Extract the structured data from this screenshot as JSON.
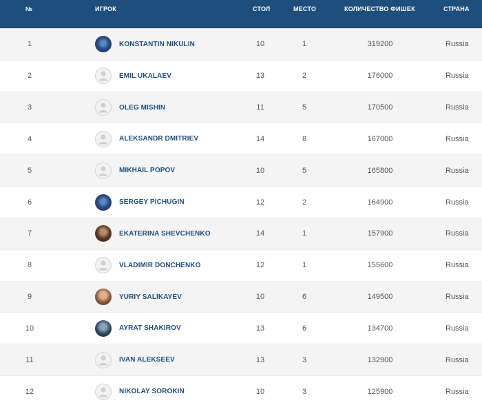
{
  "header": {
    "num": "№",
    "player": "ИГРОК",
    "table": "СТОЛ",
    "seat": "МЕСТО",
    "chips": "КОЛИЧЕСТВО ФИШЕК",
    "country": "СТРАНА"
  },
  "colors": {
    "header_bg": "#1e4e7c",
    "player_name": "#1e4e7c",
    "row_odd": "#f4f4f4",
    "row_even": "#ffffff",
    "cell_text": "#555555"
  },
  "rows": [
    {
      "num": "1",
      "avatar": "photo-blue",
      "name": "KONSTANTIN NIKULIN",
      "table": "10",
      "seat": "1",
      "chips": "319200",
      "country": "Russia"
    },
    {
      "num": "2",
      "avatar": "placeholder",
      "name": "EMIL UKALAEV",
      "table": "13",
      "seat": "2",
      "chips": "176000",
      "country": "Russia"
    },
    {
      "num": "3",
      "avatar": "placeholder",
      "name": "OLEG MISHIN",
      "table": "11",
      "seat": "5",
      "chips": "170500",
      "country": "Russia"
    },
    {
      "num": "4",
      "avatar": "placeholder",
      "name": "ALEKSANDR DMITRIEV",
      "table": "14",
      "seat": "8",
      "chips": "167000",
      "country": "Russia"
    },
    {
      "num": "5",
      "avatar": "placeholder",
      "name": "MIKHAIL POPOV",
      "table": "10",
      "seat": "5",
      "chips": "165800",
      "country": "Russia"
    },
    {
      "num": "6",
      "avatar": "photo-blue",
      "name": "SERGEY PICHUGIN",
      "table": "12",
      "seat": "2",
      "chips": "164900",
      "country": "Russia"
    },
    {
      "num": "7",
      "avatar": "photo-dark",
      "name": "EKATERINA SHEVCHENKO",
      "table": "14",
      "seat": "1",
      "chips": "157900",
      "country": "Russia"
    },
    {
      "num": "8",
      "avatar": "placeholder",
      "name": "VLADIMIR DONCHENKO",
      "table": "12",
      "seat": "1",
      "chips": "155600",
      "country": "Russia"
    },
    {
      "num": "9",
      "avatar": "photo-warm",
      "name": "YURIY SALIKAYEV",
      "table": "10",
      "seat": "6",
      "chips": "149500",
      "country": "Russia"
    },
    {
      "num": "10",
      "avatar": "photo-teal",
      "name": "AYRAT SHAKIROV",
      "table": "13",
      "seat": "6",
      "chips": "134700",
      "country": "Russia"
    },
    {
      "num": "11",
      "avatar": "placeholder",
      "name": "IVAN ALEKSEEV",
      "table": "13",
      "seat": "3",
      "chips": "132900",
      "country": "Russia"
    },
    {
      "num": "12",
      "avatar": "placeholder",
      "name": "NIKOLAY SOROKIN",
      "table": "10",
      "seat": "3",
      "chips": "125900",
      "country": "Russia"
    }
  ]
}
